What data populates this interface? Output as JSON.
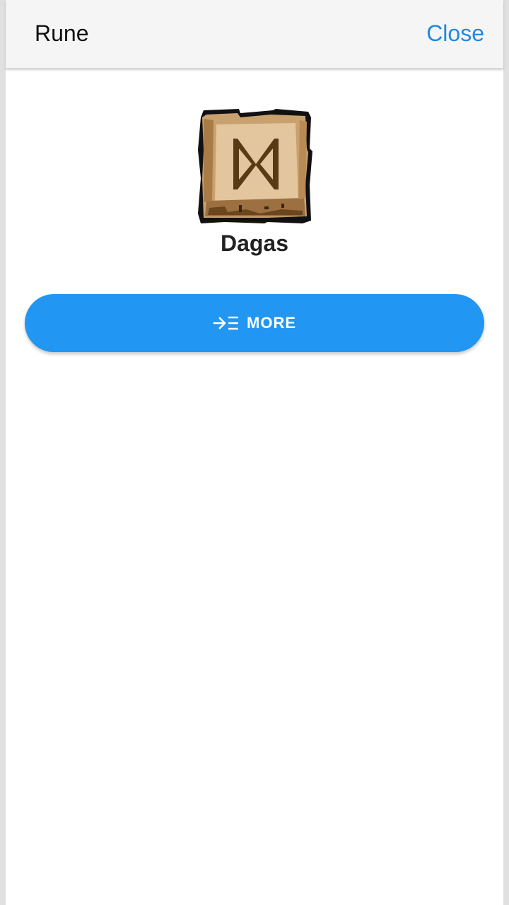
{
  "header": {
    "title": "Rune",
    "close_label": "Close"
  },
  "rune": {
    "name": "Dagas",
    "image_icon": "dagaz-rune-tile-icon"
  },
  "actions": {
    "more_label": "MORE",
    "more_icon": "arrow-right-list-icon"
  },
  "colors": {
    "accent": "#2196F3",
    "link": "#1E88E5",
    "header_bg": "#F5F5F5",
    "page_bg": "#FFFFFF",
    "tile_light": "#D9B68A",
    "tile_dark": "#5A3A14"
  }
}
